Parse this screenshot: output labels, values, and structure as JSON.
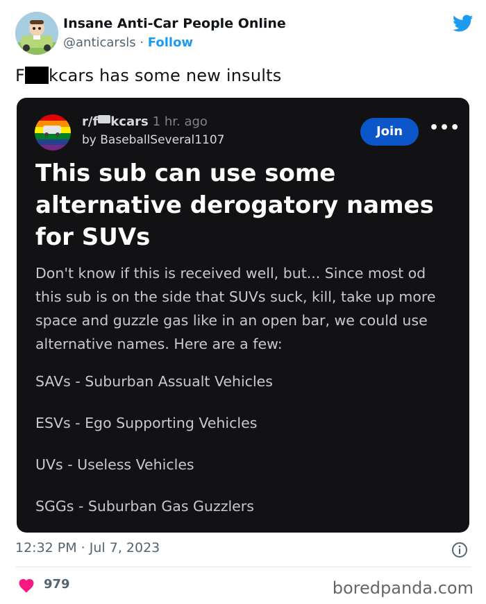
{
  "tweet": {
    "author_name": "Insane Anti-Car People Online",
    "handle": "@anticarsls",
    "separator": "·",
    "follow_label": "Follow",
    "text_prefix": "F",
    "text_suffix": "kcars has some new insults",
    "timestamp": "12:32 PM · Jul 7, 2023",
    "likes": "979"
  },
  "embedded_post": {
    "subreddit_prefix": "r/f",
    "subreddit_suffix": "kcars",
    "time_ago": "1 hr. ago",
    "by_line": "by BaseballSeveral1107",
    "join_label": "Join",
    "more_label": "•••",
    "title": "This sub can use some alternative derogatory names for SUVs",
    "body": "Don't know if this is received well, but... Since most od this sub is on the side that SUVs suck, kill, take up more space and guzzle gas like in an open bar, we could use alternative names. Here are a few:",
    "items": [
      "SAVs - Suburban Assualt Vehicles",
      "ESVs - Ego Supporting Vehicles",
      "UVs - Useless Vehicles",
      "SGGs - Suburban Gas Guzzlers"
    ]
  },
  "watermark": "boredpanda.com",
  "colors": {
    "twitter_blue": "#1d9bf0",
    "card_background": "#121214",
    "join_button": "#0b57c9",
    "like_heart": "#f91880"
  },
  "icons": [
    "twitter-bird-icon",
    "info-icon",
    "heart-icon",
    "more-options-icon"
  ]
}
